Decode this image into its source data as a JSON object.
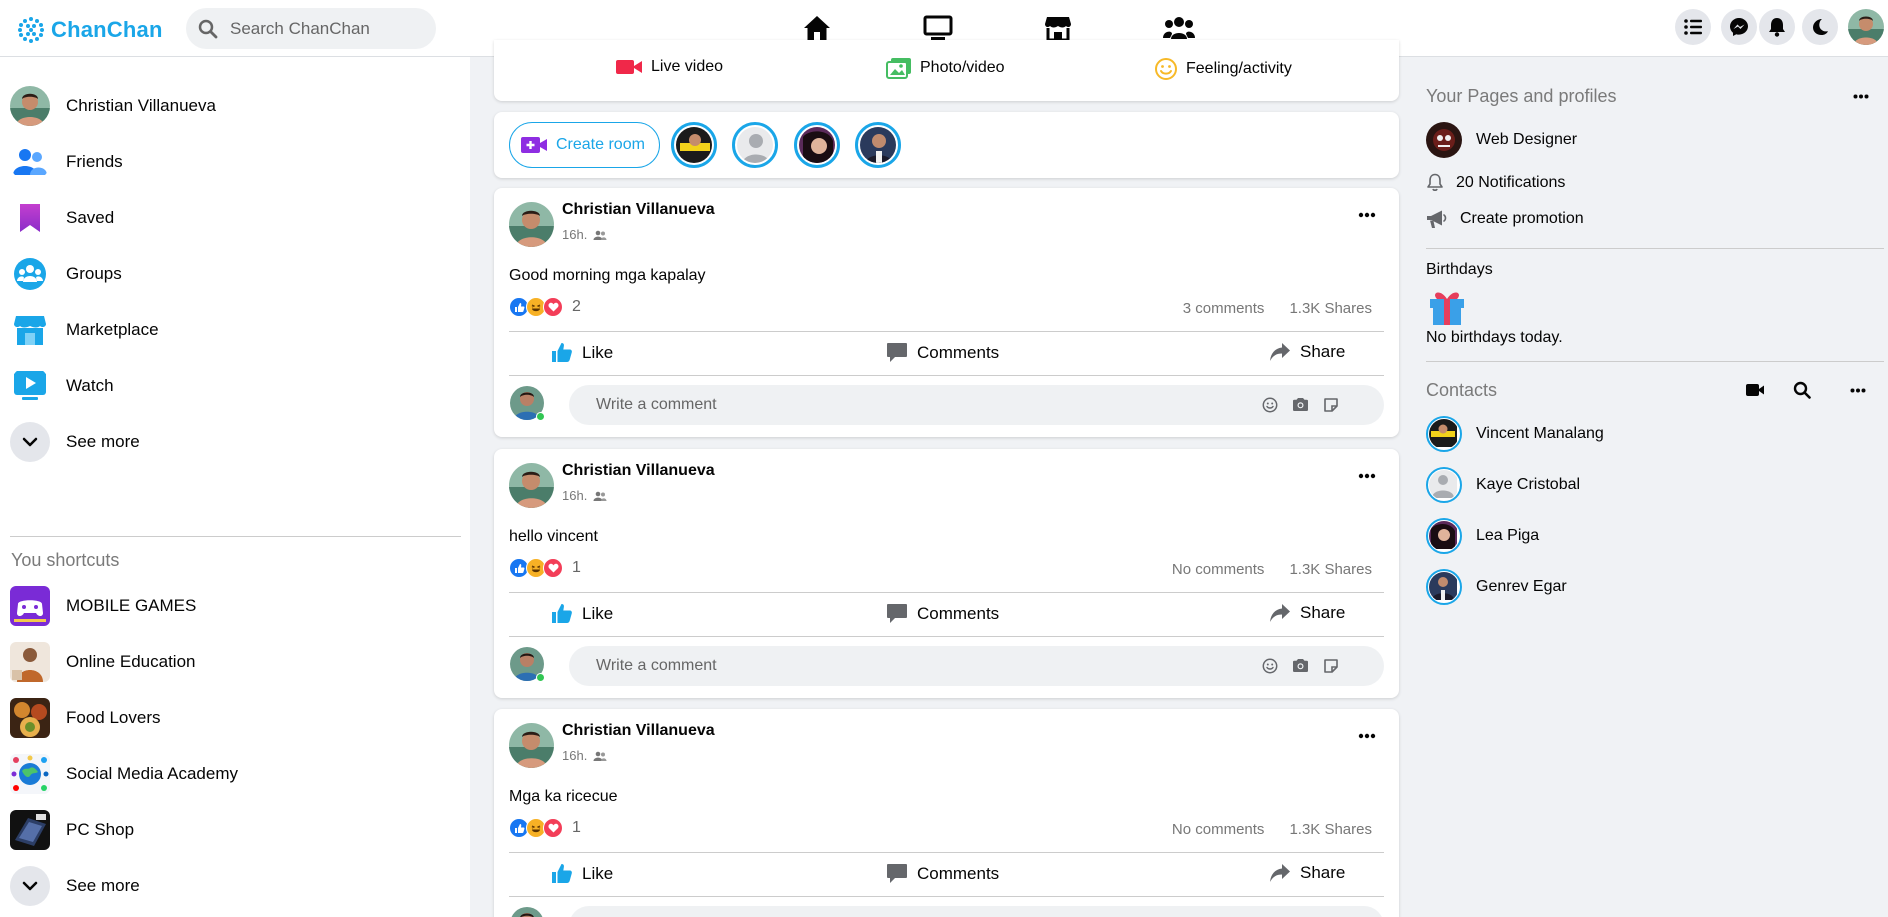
{
  "brand": {
    "name": "ChanChan",
    "color": "#1aa6e8"
  },
  "search": {
    "placeholder": "Search ChanChan"
  },
  "nav": {
    "icons": [
      "home-icon",
      "watch-tv-icon",
      "marketplace-store-icon",
      "groups-people-icon"
    ]
  },
  "header_right": {
    "icons": [
      "menu-list-icon",
      "messenger-icon",
      "notifications-bell-icon",
      "dark-mode-moon-icon"
    ]
  },
  "sidebar": {
    "items": [
      {
        "label": "Christian Villanueva"
      },
      {
        "label": "Friends"
      },
      {
        "label": "Saved"
      },
      {
        "label": "Groups"
      },
      {
        "label": "Marketplace"
      },
      {
        "label": "Watch"
      },
      {
        "label": "See more"
      }
    ],
    "shortcuts_title": "You shortcuts",
    "shortcuts": [
      {
        "label": "MOBILE GAMES"
      },
      {
        "label": "Online Education"
      },
      {
        "label": "Food Lovers"
      },
      {
        "label": "Social Media Academy"
      },
      {
        "label": "PC Shop"
      },
      {
        "label": "See more"
      }
    ]
  },
  "composer": {
    "live_video": "Live video",
    "photo_video": "Photo/video",
    "feeling": "Feeling/activity"
  },
  "rooms": {
    "create_room": "Create room"
  },
  "posts": [
    {
      "author": "Christian Villanueva",
      "time": "16h.",
      "text": "Good morning mga kapalay",
      "reactions": "2",
      "comments": "3 comments",
      "shares": "1.3K Shares"
    },
    {
      "author": "Christian Villanueva",
      "time": "16h.",
      "text": "hello vincent",
      "reactions": "1",
      "comments": "No comments",
      "shares": "1.3K Shares"
    },
    {
      "author": "Christian Villanueva",
      "time": "16h.",
      "text": "Mga ka ricecue",
      "reactions": "1",
      "comments": "No comments",
      "shares": "1.3K Shares"
    }
  ],
  "post_actions": {
    "like": "Like",
    "comments": "Comments",
    "share": "Share",
    "comment_placeholder": "Write a comment"
  },
  "right": {
    "pages_title": "Your Pages and profiles",
    "page_name": "Web Designer",
    "notifications": "20 Notifications",
    "promotion": "Create promotion",
    "birthdays_title": "Birthdays",
    "birthdays_text": "No birthdays today.",
    "contacts_title": "Contacts",
    "contacts": [
      {
        "name": "Vincent Manalang"
      },
      {
        "name": "Kaye Cristobal"
      },
      {
        "name": "Lea Piga"
      },
      {
        "name": "Genrev Egar"
      }
    ]
  },
  "colors": {
    "accent": "#1aa6e8",
    "like": "#1877f2",
    "love": "#f33e58",
    "haha": "#f7b125",
    "live": "#f02849",
    "photo": "#45bd62",
    "online": "#31c653"
  }
}
